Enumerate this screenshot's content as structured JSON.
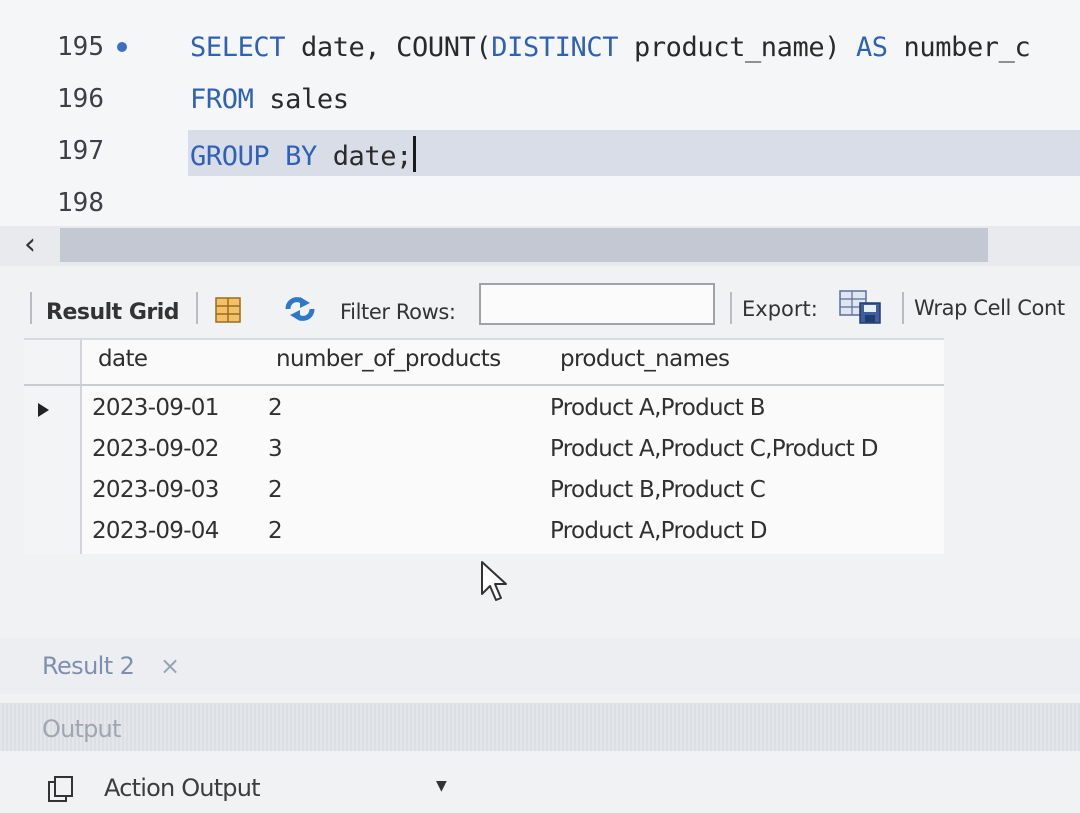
{
  "editor": {
    "lines": [
      {
        "number": "195",
        "has_dot": true,
        "tokens": [
          {
            "kind": "kw",
            "text": "SELECT"
          },
          {
            "kind": "pl",
            "text": " date, COUNT("
          },
          {
            "kind": "kw",
            "text": "DISTINCT"
          },
          {
            "kind": "pl",
            "text": " product_name) "
          },
          {
            "kind": "kw",
            "text": "AS"
          },
          {
            "kind": "pl",
            "text": " number_c"
          }
        ]
      },
      {
        "number": "196",
        "has_dot": false,
        "tokens": [
          {
            "kind": "kw",
            "text": "FROM"
          },
          {
            "kind": "pl",
            "text": " sales"
          }
        ]
      },
      {
        "number": "197",
        "has_dot": false,
        "current": true,
        "tokens": [
          {
            "kind": "kw",
            "text": "GROUP BY"
          },
          {
            "kind": "pl",
            "text": " date;"
          }
        ]
      },
      {
        "number": "198",
        "has_dot": false,
        "tokens": []
      }
    ]
  },
  "toolbar": {
    "result_grid_label": "Result Grid",
    "filter_label": "Filter Rows:",
    "filter_value": "",
    "export_label": "Export:",
    "wrap_label": "Wrap Cell Cont"
  },
  "grid": {
    "columns": [
      "date",
      "number_of_products",
      "product_names"
    ],
    "rows": [
      [
        "2023-09-01",
        "2",
        "Product A,Product B"
      ],
      [
        "2023-09-02",
        "3",
        "Product A,Product C,Product D"
      ],
      [
        "2023-09-03",
        "2",
        "Product B,Product C"
      ],
      [
        "2023-09-04",
        "2",
        "Product A,Product D"
      ]
    ],
    "selected_row": 0
  },
  "bottom": {
    "result_tab_label": "Result 2",
    "result_tab_close": "×",
    "output_label": "Output",
    "action_output_label": "Action Output",
    "action_caret": "▼"
  },
  "colors": {
    "keyword": "#2f62b7",
    "current_line": "#d9dde7",
    "result_tab": "#7e90ad"
  }
}
